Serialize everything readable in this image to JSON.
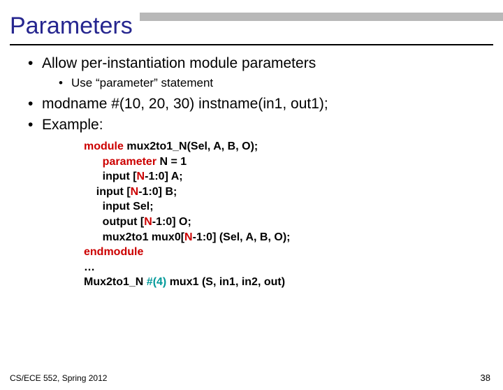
{
  "topbar": {},
  "title": "Parameters",
  "bullets": {
    "b1": "Allow per-instantiation module parameters",
    "b1_sub": "Use “parameter” statement",
    "b2": "modname #(10, 20, 30) instname(in1, out1);",
    "b3": "Example:"
  },
  "code": {
    "l1a": "module",
    "l1b": " mux2to1_N(Sel, A, B, O);",
    "l2a": "      parameter",
    "l2b": " N = 1",
    "l3a": "      input [",
    "l3b": "N",
    "l3c": "-1:0] A;",
    "l4a": "    input [",
    "l4b": "N",
    "l4c": "-1:0] B;",
    "l5": "      input Sel;",
    "l6a": "      output [",
    "l6b": "N",
    "l6c": "-1:0] O;",
    "l7a": "      mux2to1 mux0[",
    "l7b": "N",
    "l7c": "-1:0] (Sel, A, B, O);",
    "l8": "endmodule",
    "l9": "…",
    "l10a": "Mux2to1_N ",
    "l10b": "#(4)",
    "l10c": " mux1 (S, in1, in2, out)"
  },
  "footer": {
    "left": "CS/ECE 552, Spring 2012",
    "right": "38"
  }
}
